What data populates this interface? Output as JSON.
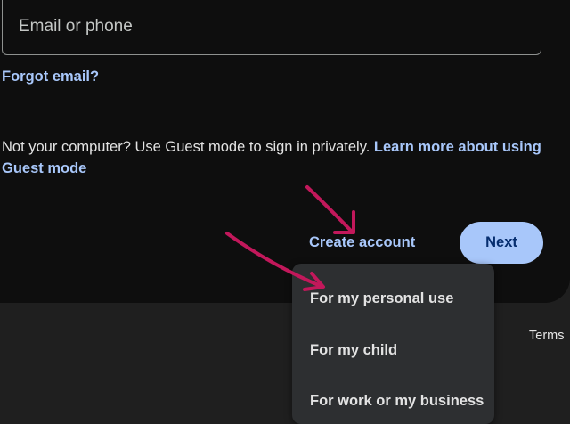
{
  "signin": {
    "email_placeholder": "Email or phone",
    "forgot_email": "Forgot email?",
    "guest_text": "Not your computer? Use Guest mode to sign in privately. ",
    "guest_link": "Learn more about using Guest mode",
    "create_account": "Create account",
    "next": "Next"
  },
  "create_account_menu": {
    "items": [
      {
        "label": "For my personal use"
      },
      {
        "label": "For my child"
      },
      {
        "label": "For work or my business"
      }
    ]
  },
  "footer": {
    "terms": "Terms"
  },
  "colors": {
    "page_background": "#1f1f1f",
    "card_background": "#0e0e0e",
    "link": "#a8c7fa",
    "primary_button": "#a8c7fa",
    "menu_background": "#2d2f31",
    "annotation_arrow": "#c2185b"
  },
  "annotations": {
    "icon": "arrow-annotation-icon",
    "count": 2
  }
}
